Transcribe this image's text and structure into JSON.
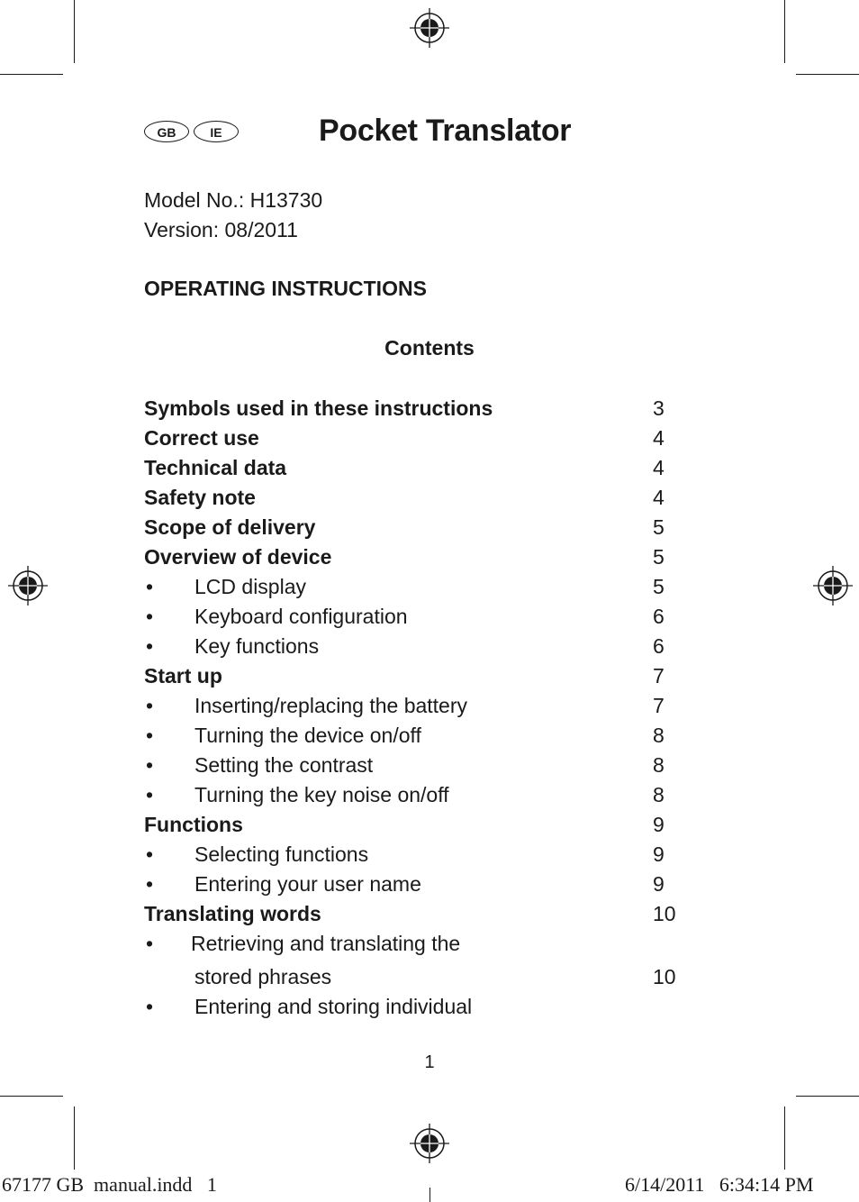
{
  "badges": [
    "GB",
    "IE"
  ],
  "title": "Pocket Translator",
  "model": "Model No.: H13730",
  "version": "Version: 08/2011",
  "heading": "OPERATING INSTRUCTIONS",
  "contents_title": "Contents",
  "toc": [
    {
      "label": "Symbols used in these instructions",
      "page": "3",
      "level": 0
    },
    {
      "label": "Correct use",
      "page": "4",
      "level": 0
    },
    {
      "label": "Technical data",
      "page": "4",
      "level": 0
    },
    {
      "label": "Safety note",
      "page": "4",
      "level": 0
    },
    {
      "label": "Scope of delivery",
      "page": "5",
      "level": 0
    },
    {
      "label": "Overview of device",
      "page": "5",
      "level": 0
    },
    {
      "label": "LCD display",
      "page": "5",
      "level": 1
    },
    {
      "label": "Keyboard configuration",
      "page": "6",
      "level": 1
    },
    {
      "label": "Key functions",
      "page": "6",
      "level": 1
    },
    {
      "label": "Start up",
      "page": "7",
      "level": 0
    },
    {
      "label": "Inserting/replacing the battery",
      "page": "7",
      "level": 1
    },
    {
      "label": "Turning the device on/off",
      "page": "8",
      "level": 1
    },
    {
      "label": "Setting the contrast",
      "page": "8",
      "level": 1
    },
    {
      "label": "Turning the key noise on/off",
      "page": "8",
      "level": 1
    },
    {
      "label": "Functions",
      "page": "9",
      "level": 0
    },
    {
      "label": "Selecting functions",
      "page": "9",
      "level": 1
    },
    {
      "label": "Entering your user name",
      "page": "9",
      "level": 1
    },
    {
      "label": "Translating words",
      "page": "10",
      "level": 0
    },
    {
      "label": "Retrieving and translating the",
      "page": "",
      "level": 1
    },
    {
      "label": "stored phrases",
      "page": "10",
      "level": 2
    },
    {
      "label": "Entering and storing individual",
      "page": "",
      "level": 1
    }
  ],
  "bullet": "•",
  "page_number": "1",
  "slug_left": "67177 GB  manual.indd   1",
  "slug_right": "6/14/2011   6:34:14 PM"
}
